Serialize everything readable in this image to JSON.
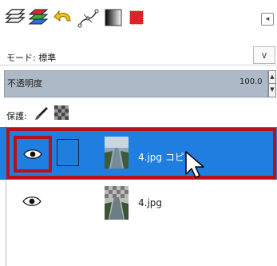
{
  "mode": {
    "label": "モード: 標準",
    "dropdown_glyph": "∨"
  },
  "opacity": {
    "label": "不透明度",
    "value": "100.0",
    "up": "▲",
    "down": "▼"
  },
  "lock": {
    "label": "保護:"
  },
  "layers": [
    {
      "name": "4.jpg コピー",
      "selected": true,
      "visible": true
    },
    {
      "name": "4.jpg",
      "selected": false,
      "visible": true
    }
  ],
  "menu_glyph": "◂",
  "colors": {
    "selection": "#1f7ee0",
    "highlight": "#b5121b",
    "opacity_bg": "#aeb9c7"
  },
  "icons": [
    "layers-icon",
    "channels-icon",
    "undo-history-icon",
    "paths-icon",
    "gradient-icon",
    "color-swatch-icon"
  ]
}
